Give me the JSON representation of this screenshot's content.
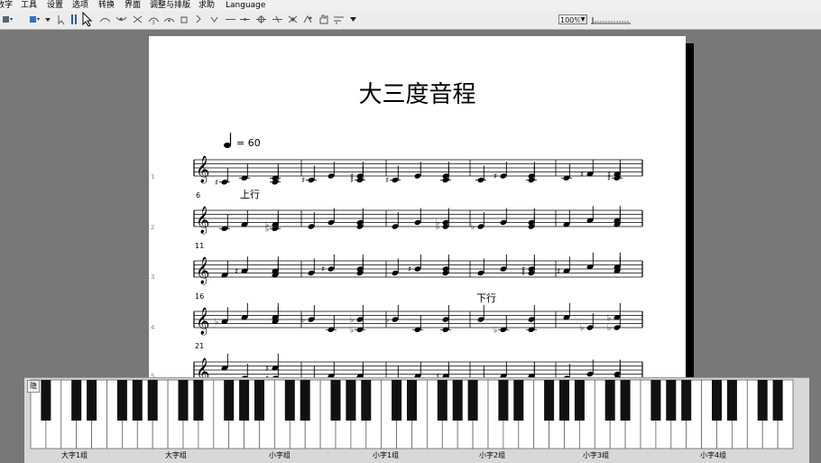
{
  "menu": {
    "items": [
      "数字",
      "工具",
      "设置",
      "选项",
      "转换",
      "界面",
      "调整与排版",
      "求助",
      "Language"
    ]
  },
  "toolbar": {
    "zoom": "100%",
    "tools": [
      "layout-icon",
      "color-square-icon",
      "cursor-icon",
      "bars-icon",
      "select-arrow-icon",
      "slur-icon",
      "tie-icon",
      "phrase-icon",
      "triplet-icon",
      "fermata-icon",
      "accent-icon",
      "staccato-icon",
      "tenuto-icon",
      "wedge-icon",
      "trill-icon",
      "mordent-icon",
      "turn-icon",
      "arpeggio-icon",
      "dropdown-icon"
    ]
  },
  "score": {
    "title": "大三度音程",
    "tempo_value": "= 60",
    "labels": {
      "up": "上行",
      "down": "下行"
    },
    "measure_numbers": [
      "6",
      "11",
      "16",
      "21"
    ],
    "line_numbers": [
      "1",
      "2",
      "3",
      "4",
      "5"
    ]
  },
  "keyboard": {
    "hide_label": "隐",
    "groups": [
      "大字1组",
      "大字组",
      "小字组",
      "小字1组",
      "小字2组",
      "小字3组",
      "小字4组"
    ]
  }
}
